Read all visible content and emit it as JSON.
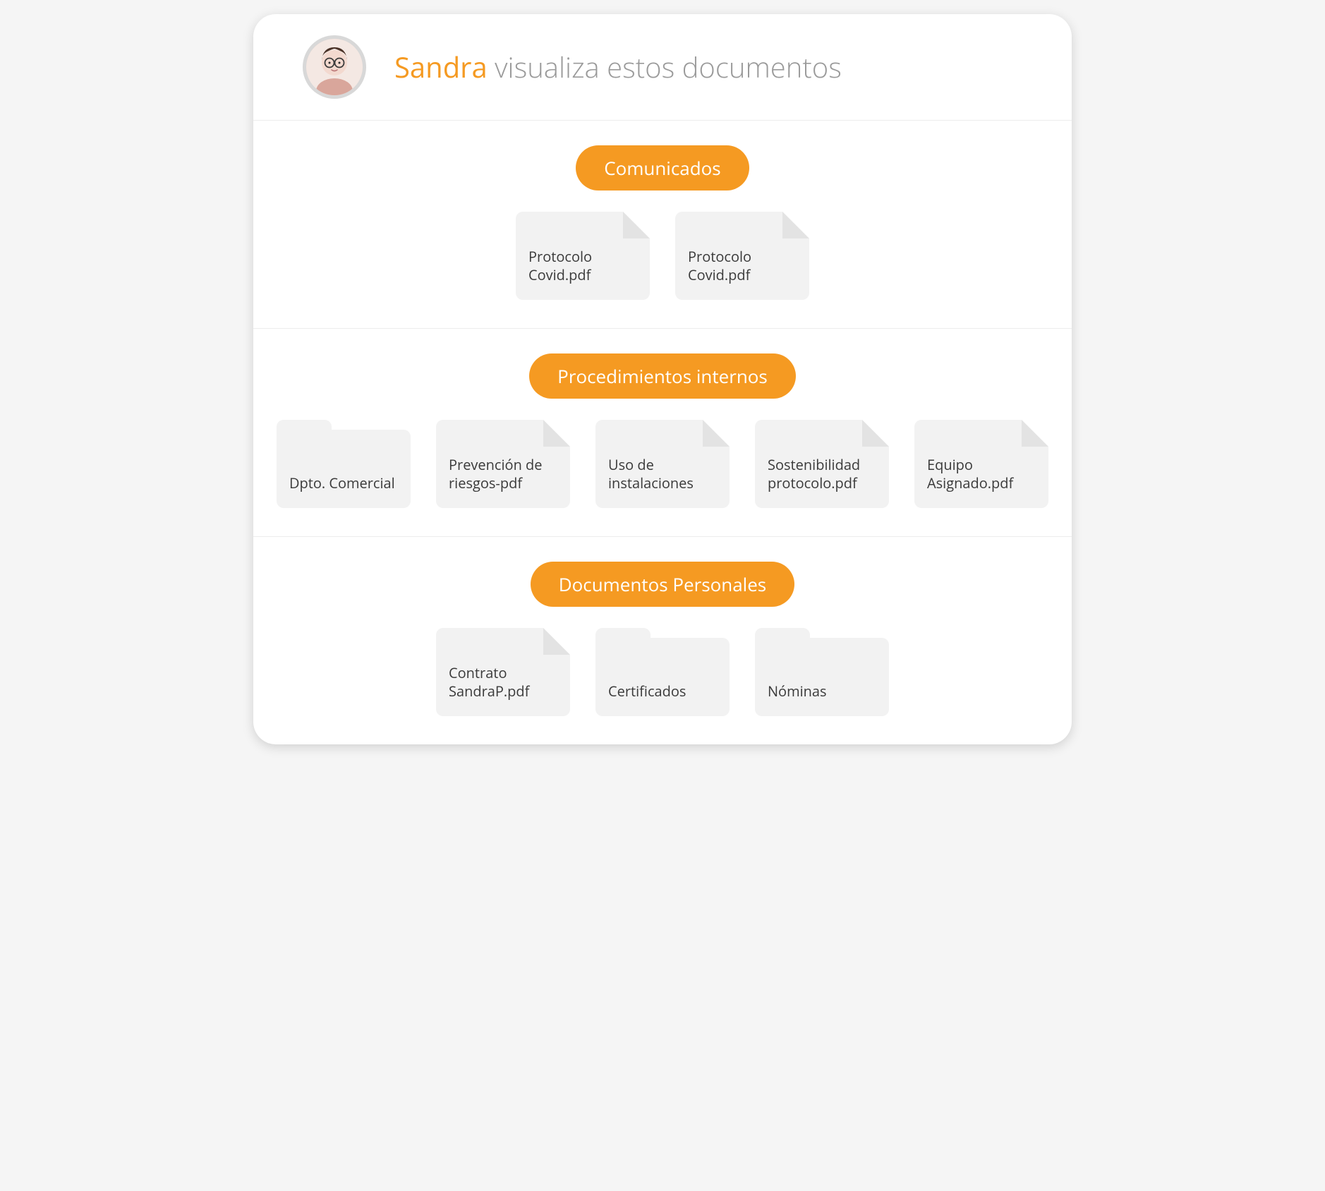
{
  "header": {
    "user_name": "Sandra",
    "title_rest": " visualiza estos documentos"
  },
  "sections": [
    {
      "pill": "Comunicados",
      "items": [
        {
          "type": "file",
          "label": "Protocolo Covid.pdf"
        },
        {
          "type": "file",
          "label": "Protocolo Covid.pdf"
        }
      ]
    },
    {
      "pill": "Procedimientos internos",
      "items": [
        {
          "type": "folder",
          "label": "Dpto. Comercial"
        },
        {
          "type": "file",
          "label": "Prevención de riesgos-pdf"
        },
        {
          "type": "file",
          "label": "Uso de instalaciones"
        },
        {
          "type": "file",
          "label": "Sostenibilidad protocolo.pdf"
        },
        {
          "type": "file",
          "label": "Equipo Asignado.pdf"
        }
      ]
    },
    {
      "pill": "Documentos Personales",
      "items": [
        {
          "type": "file",
          "label": "Contrato SandraP.pdf"
        },
        {
          "type": "folder",
          "label": "Certificados"
        },
        {
          "type": "folder",
          "label": "Nóminas"
        }
      ]
    }
  ]
}
